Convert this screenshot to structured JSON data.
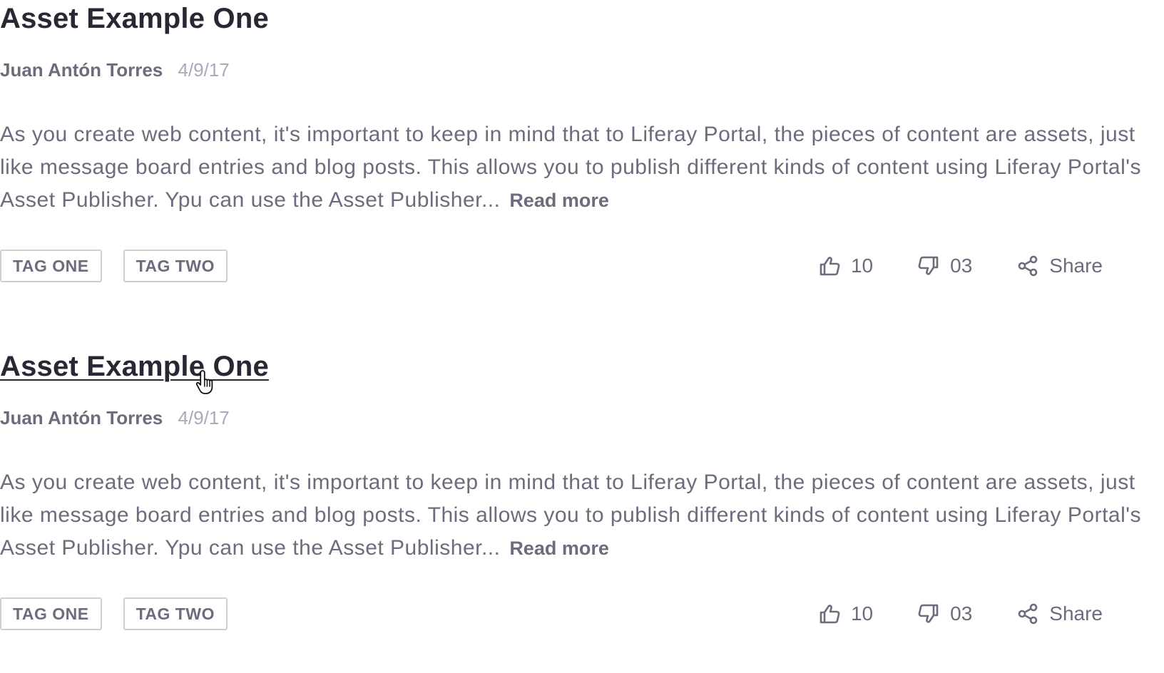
{
  "entries": [
    {
      "title": "Asset Example One",
      "author": "Juan Antón Torres",
      "date": "4/9/17",
      "summary": "As you create web content, it's important to keep in mind that to Liferay Portal, the pieces of content are assets, just like message board entries and blog posts. This allows you to publish different kinds of content using Liferay Portal's Asset Publisher. Ypu can use the Asset Publisher...",
      "read_more": "Read more",
      "tags": [
        "TAG ONE",
        "TAG TWO"
      ],
      "likes": "10",
      "dislikes": "03",
      "share_label": "Share"
    },
    {
      "title": "Asset Example One",
      "author": "Juan Antón Torres",
      "date": "4/9/17",
      "summary": "As you create web content, it's important to keep in mind that to Liferay Portal, the pieces of content are assets, just like message board entries and blog posts. This allows you to publish different kinds of content using Liferay Portal's Asset Publisher. Ypu can use the Asset Publisher...",
      "read_more": "Read more",
      "tags": [
        "TAG ONE",
        "TAG TWO"
      ],
      "likes": "10",
      "dislikes": "03",
      "share_label": "Share"
    }
  ],
  "icons": {
    "like": "thumbs-up-icon",
    "dislike": "thumbs-down-icon",
    "share": "share-icon",
    "cursor": "hand-pointer-cursor"
  },
  "colors": {
    "title": "#272833",
    "secondary_text": "#6b6c7e",
    "date": "#a7a9bc",
    "tag_border": "#cdced9"
  }
}
